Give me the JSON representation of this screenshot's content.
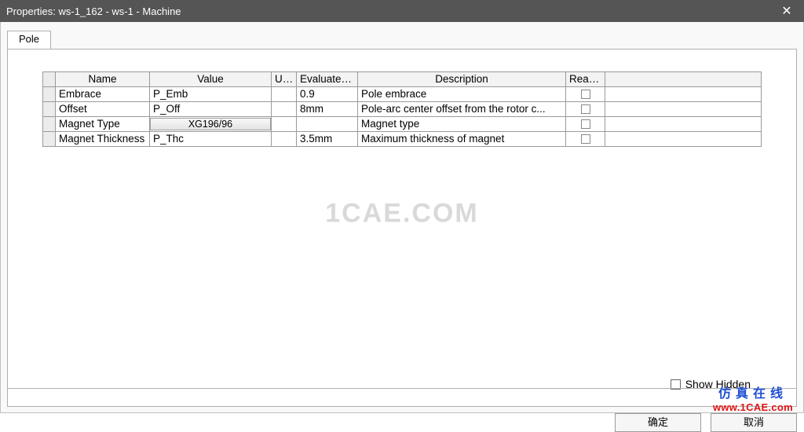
{
  "window": {
    "title": "Properties: ws-1_162 - ws-1 - Machine",
    "close_glyph": "✕"
  },
  "tab": {
    "label": "Pole"
  },
  "grid": {
    "headers": {
      "name": "Name",
      "value": "Value",
      "unit": "Unit",
      "evaluated": "Evaluated...",
      "description": "Description",
      "readonly": "Read-o..."
    },
    "rows": [
      {
        "name": "Embrace",
        "value": "P_Emb",
        "value_is_button": false,
        "unit": "",
        "evaluated": "0.9",
        "description": "Pole embrace",
        "readonly": false
      },
      {
        "name": "Offset",
        "value": "P_Off",
        "value_is_button": false,
        "unit": "",
        "evaluated": "8mm",
        "description": "Pole-arc center offset from the rotor c...",
        "readonly": false
      },
      {
        "name": "Magnet Type",
        "value": "XG196/96",
        "value_is_button": true,
        "unit": "",
        "evaluated": "",
        "description": "Magnet type",
        "readonly": false
      },
      {
        "name": "Magnet Thickness",
        "value": "P_Thc",
        "value_is_button": false,
        "unit": "",
        "evaluated": "3.5mm",
        "description": "Maximum thickness of magnet",
        "readonly": false
      }
    ]
  },
  "show_hidden_label": "Show Hidden",
  "buttons": {
    "ok": "确定",
    "cancel": "取消"
  },
  "watermarks": {
    "center": "1CAE.COM",
    "overlay_cn": "仿真在线",
    "overlay_url": "www.1CAE.com"
  }
}
